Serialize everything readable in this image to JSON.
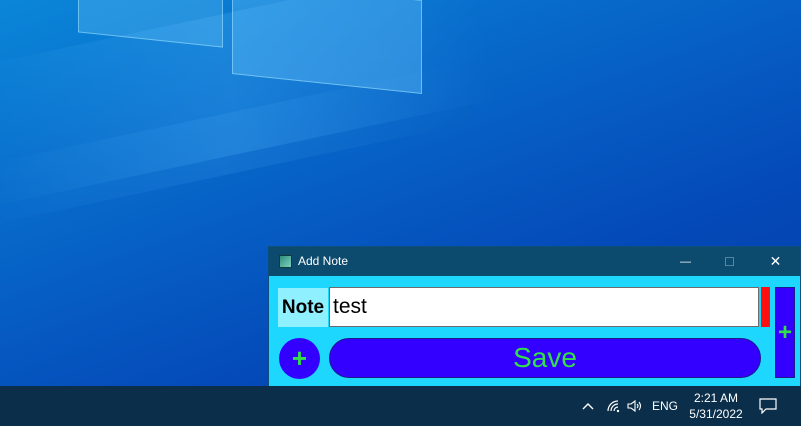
{
  "window": {
    "title": "Add Note",
    "minimize_glyph": "—",
    "maximize_glyph": "☐",
    "close_glyph": "✕"
  },
  "form": {
    "note_label": "Note",
    "note_value": "test",
    "add_glyph": "+",
    "side_add_glyph": "+",
    "save_label": "Save",
    "color_strip": "#ff1010"
  },
  "taskbar": {
    "chevron_glyph": "^",
    "language": "ENG",
    "time": "2:21 AM",
    "date": "5/31/2022"
  },
  "colors": {
    "window_body": "#1ed7ff",
    "title_bar": "#0c4a6e",
    "button_bg": "#3300ff",
    "button_text": "#33e04a",
    "note_label_bg": "#8ff0ff",
    "taskbar": "#0b2f4a"
  },
  "icons": {
    "app": "app-icon",
    "network": "wifi-icon",
    "volume": "speaker-icon",
    "notifications": "action-center-icon"
  }
}
